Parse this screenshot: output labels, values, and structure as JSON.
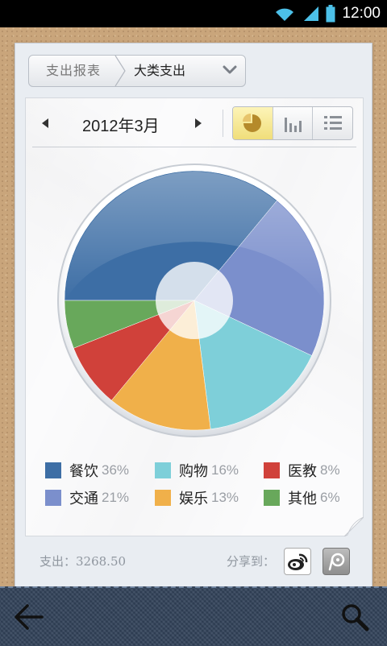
{
  "status_bar": {
    "time": "12:00"
  },
  "header": {
    "breadcrumb_root": "支出报表",
    "breadcrumb_current": "大类支出"
  },
  "period": {
    "label": "2012年3月"
  },
  "view_modes": {
    "active": "pie",
    "options": [
      "pie",
      "bar",
      "list"
    ]
  },
  "chart_data": {
    "type": "pie",
    "donut": true,
    "slices": [
      {
        "name": "餐饮",
        "percent": 36,
        "label": "36%",
        "color": "#3d6ea5"
      },
      {
        "name": "交通",
        "percent": 21,
        "label": "21%",
        "color": "#7b8fcc"
      },
      {
        "name": "购物",
        "percent": 16,
        "label": "16%",
        "color": "#7ecfd9"
      },
      {
        "name": "娱乐",
        "percent": 13,
        "label": "13%",
        "color": "#f0b04a"
      },
      {
        "name": "医教",
        "percent": 8,
        "label": "8%",
        "color": "#d0413a"
      },
      {
        "name": "其他",
        "percent": 6,
        "label": "6%",
        "color": "#68a85b"
      }
    ]
  },
  "legend_order": [
    [
      "餐饮",
      "购物",
      "医教"
    ],
    [
      "交通",
      "娱乐",
      "其他"
    ]
  ],
  "footer": {
    "total_text": "支出：3268.50",
    "share_label": "分享到："
  },
  "icons": {
    "back": "back-arrow-icon",
    "search": "search-icon",
    "share_weibo": "weibo-icon",
    "share_tencent": "tencent-weibo-icon"
  }
}
